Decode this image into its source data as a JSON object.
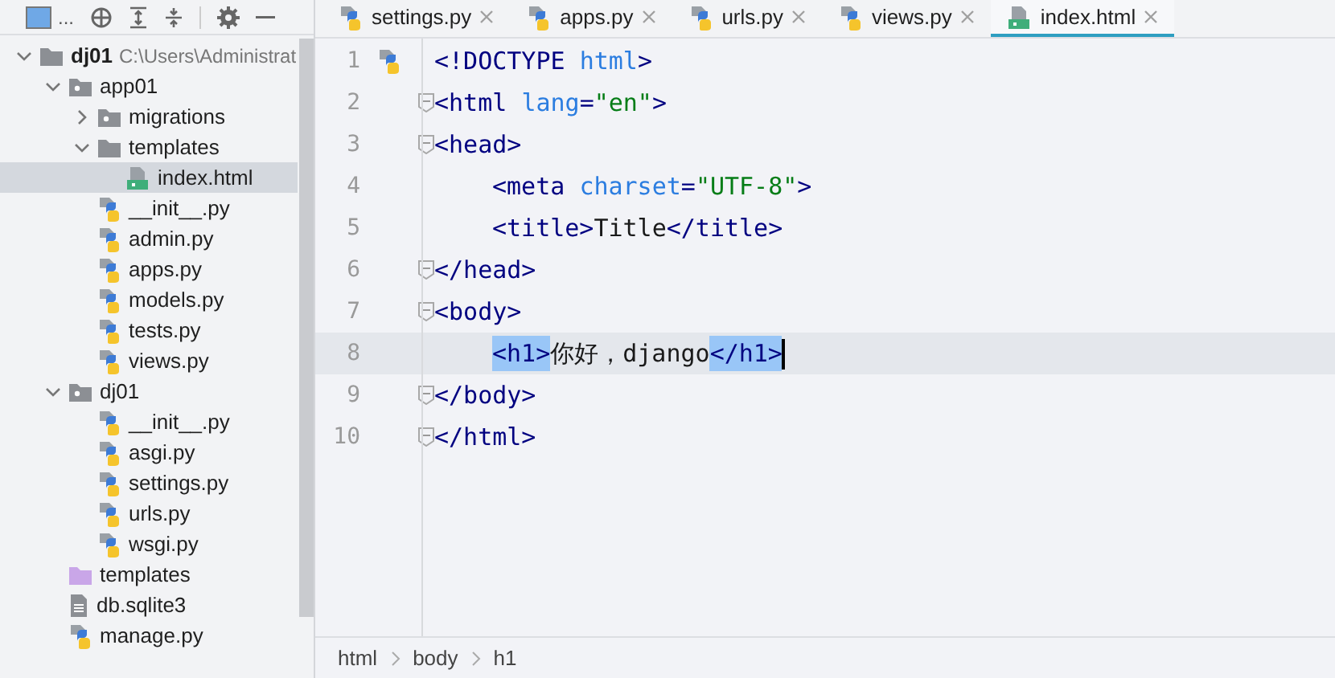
{
  "project_toolbar": {
    "view_label": "..."
  },
  "tree": [
    {
      "name": "dj01",
      "path": "C:\\Users\\Administrat",
      "kind": "folder",
      "expanded": true,
      "selected": false,
      "children": [
        {
          "name": "app01",
          "kind": "package",
          "expanded": true,
          "selected": false,
          "children": [
            {
              "name": "migrations",
              "kind": "package",
              "expanded": false,
              "selected": false
            },
            {
              "name": "templates",
              "kind": "folder",
              "expanded": true,
              "selected": false,
              "children": [
                {
                  "name": "index.html",
                  "kind": "html",
                  "selected": true
                }
              ]
            },
            {
              "name": "__init__.py",
              "kind": "python",
              "selected": false
            },
            {
              "name": "admin.py",
              "kind": "python",
              "selected": false
            },
            {
              "name": "apps.py",
              "kind": "python",
              "selected": false
            },
            {
              "name": "models.py",
              "kind": "python",
              "selected": false
            },
            {
              "name": "tests.py",
              "kind": "python",
              "selected": false
            },
            {
              "name": "views.py",
              "kind": "python",
              "selected": false
            }
          ]
        },
        {
          "name": "dj01",
          "kind": "package",
          "expanded": true,
          "selected": false,
          "children": [
            {
              "name": "__init__.py",
              "kind": "python",
              "selected": false
            },
            {
              "name": "asgi.py",
              "kind": "python",
              "selected": false
            },
            {
              "name": "settings.py",
              "kind": "python",
              "selected": false
            },
            {
              "name": "urls.py",
              "kind": "python",
              "selected": false
            },
            {
              "name": "wsgi.py",
              "kind": "python",
              "selected": false
            }
          ]
        },
        {
          "name": "templates",
          "kind": "template_folder",
          "selected": false
        },
        {
          "name": "db.sqlite3",
          "kind": "text",
          "selected": false
        },
        {
          "name": "manage.py",
          "kind": "python",
          "selected": false
        }
      ]
    }
  ],
  "tabs": [
    {
      "label": "settings.py",
      "kind": "python",
      "selected": false
    },
    {
      "label": "apps.py",
      "kind": "python",
      "selected": false
    },
    {
      "label": "urls.py",
      "kind": "python",
      "selected": false
    },
    {
      "label": "views.py",
      "kind": "python",
      "selected": false
    },
    {
      "label": "index.html",
      "kind": "html",
      "selected": true
    }
  ],
  "editor": {
    "lines": [
      {
        "number": "1",
        "gutter_icon": true,
        "indent": false,
        "fold": false,
        "current": false,
        "tokens": [
          {
            "kind": "tag",
            "text": "<!DOCTYPE "
          },
          {
            "kind": "attr",
            "text": "html"
          },
          {
            "kind": "tag",
            "text": ">"
          }
        ]
      },
      {
        "number": "2",
        "gutter_icon": false,
        "indent": false,
        "fold": true,
        "current": false,
        "tokens": [
          {
            "kind": "tag",
            "text": "<html "
          },
          {
            "kind": "attr",
            "text": "lang"
          },
          {
            "kind": "tag",
            "text": "="
          },
          {
            "kind": "string",
            "text": "\"en\""
          },
          {
            "kind": "tag",
            "text": ">"
          }
        ]
      },
      {
        "number": "3",
        "gutter_icon": false,
        "indent": false,
        "fold": true,
        "current": false,
        "tokens": [
          {
            "kind": "tag",
            "text": "<head>"
          }
        ]
      },
      {
        "number": "4",
        "gutter_icon": false,
        "indent": true,
        "fold": false,
        "current": false,
        "tokens": [
          {
            "kind": "tag",
            "text": "<meta "
          },
          {
            "kind": "attr",
            "text": "charset"
          },
          {
            "kind": "tag",
            "text": "="
          },
          {
            "kind": "string",
            "text": "\"UTF-8\""
          },
          {
            "kind": "tag",
            "text": ">"
          }
        ]
      },
      {
        "number": "5",
        "gutter_icon": false,
        "indent": true,
        "fold": false,
        "current": false,
        "tokens": [
          {
            "kind": "tag",
            "text": "<title>"
          },
          {
            "kind": "plain",
            "text": "Title"
          },
          {
            "kind": "tag",
            "text": "</title>"
          }
        ]
      },
      {
        "number": "6",
        "gutter_icon": false,
        "indent": false,
        "fold": true,
        "current": false,
        "tokens": [
          {
            "kind": "tag",
            "text": "</head>"
          }
        ]
      },
      {
        "number": "7",
        "gutter_icon": false,
        "indent": false,
        "fold": true,
        "current": false,
        "tokens": [
          {
            "kind": "tag",
            "text": "<body>"
          }
        ]
      },
      {
        "number": "8",
        "gutter_icon": false,
        "indent": true,
        "fold": false,
        "current": true,
        "caret": true,
        "tokens": [
          {
            "kind": "tag",
            "text": "<h1>",
            "matched": true
          },
          {
            "kind": "plain",
            "text": "你好，django"
          },
          {
            "kind": "tag",
            "text": "</h1>",
            "matched": true
          }
        ]
      },
      {
        "number": "9",
        "gutter_icon": false,
        "indent": false,
        "fold": true,
        "current": false,
        "tokens": [
          {
            "kind": "tag",
            "text": "</body>"
          }
        ]
      },
      {
        "number": "10",
        "gutter_icon": false,
        "indent": false,
        "fold": true,
        "current": false,
        "tokens": [
          {
            "kind": "tag",
            "text": "</html>"
          }
        ]
      }
    ]
  },
  "breadcrumbs": [
    "html",
    "body",
    "h1"
  ]
}
